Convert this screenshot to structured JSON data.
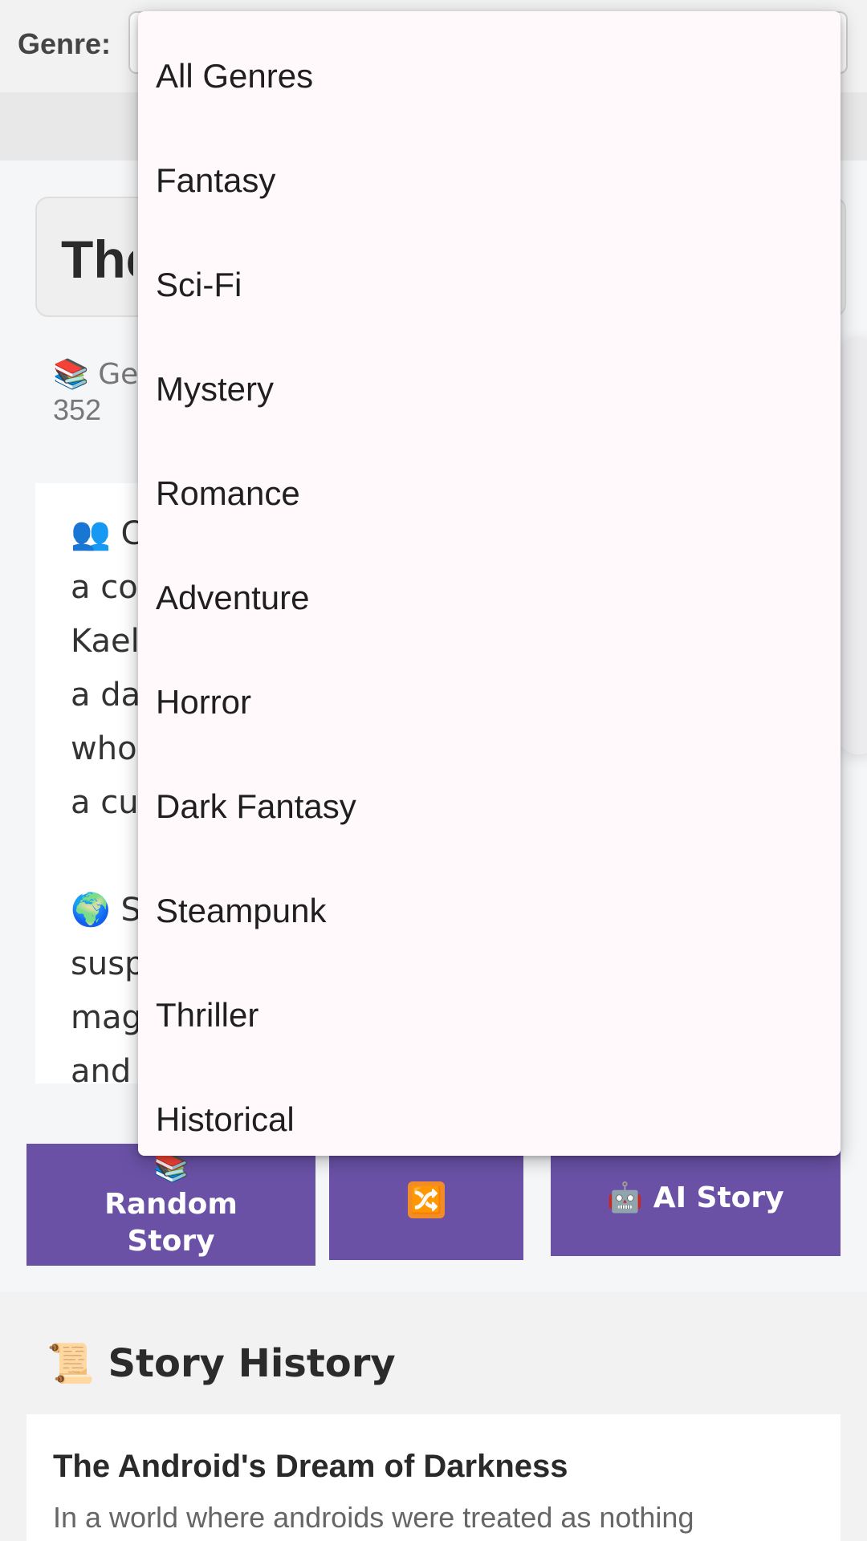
{
  "filter": {
    "genre_label": "Genre:"
  },
  "story": {
    "title_visible": "The",
    "meta_line1": "📚 Ge",
    "meta_line2": "352",
    "text_visible": "👥 C\na co\nKael\na da\nwho\na cu\n\n🌍 S\nsusp\nmag\nand"
  },
  "actions": {
    "random_label": "📚 Random Story",
    "shuffle_icon": "🔀",
    "ai_label": "🤖 AI Story"
  },
  "history": {
    "heading": "📜 Story History",
    "items": [
      {
        "title": "The Android's Dream of Darkness",
        "snippet": "In a world where androids were treated as nothing"
      }
    ]
  },
  "dropdown": {
    "options": [
      "All Genres",
      "Fantasy",
      "Sci-Fi",
      "Mystery",
      "Romance",
      "Adventure",
      "Horror",
      "Dark Fantasy",
      "Steampunk",
      "Thriller",
      "Historical"
    ]
  },
  "colors": {
    "accent": "#6a51a6",
    "dropdown_bg": "#fff9fc"
  }
}
